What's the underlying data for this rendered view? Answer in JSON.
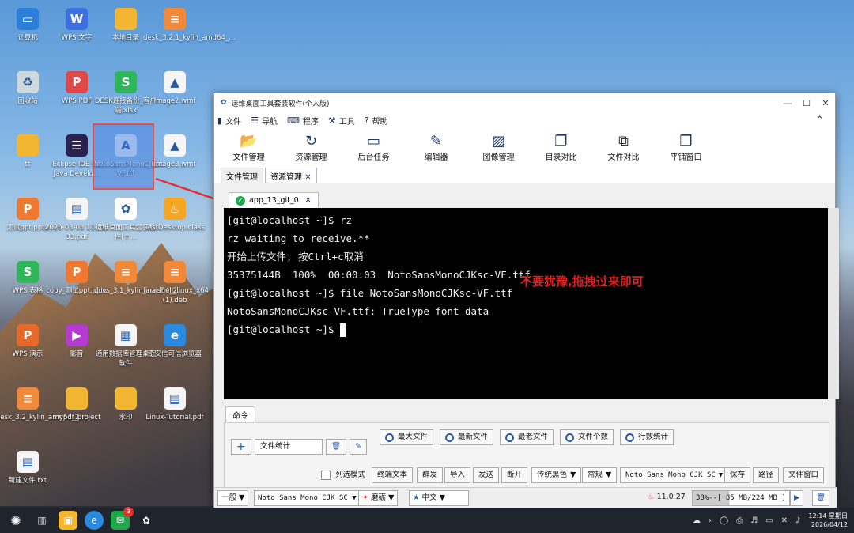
{
  "desktop": {
    "icons": [
      {
        "label": "计算机",
        "color": "#2b7fd8",
        "glyph": "▭",
        "icon": "computer-icon"
      },
      {
        "label": "WPS 文字",
        "color": "#3c6fe0",
        "glyph": "W",
        "icon": "wps-writer-icon"
      },
      {
        "label": "本地目录",
        "color": "#f2b632",
        "glyph": "",
        "icon": "folder-icon"
      },
      {
        "label": "desk_3.2.1_kylin_amd64_…",
        "color": "#f08a3a",
        "glyph": "≡",
        "icon": "archive-icon"
      },
      {
        "label": "回收站",
        "color": "#cfd8dc",
        "glyph": "♻",
        "icon": "trash-icon"
      },
      {
        "label": "WPS PDF",
        "color": "#e04848",
        "glyph": "P",
        "icon": "wps-pdf-icon"
      },
      {
        "label": "DESK连接备份_客户端.xlsx",
        "color": "#2fb55a",
        "glyph": "S",
        "icon": "xlsx-icon"
      },
      {
        "label": "image2.wmf",
        "color": "#f5f5f5",
        "glyph": "▲",
        "icon": "image-file-icon"
      },
      {
        "label": "tt",
        "color": "#f2b632",
        "glyph": "",
        "icon": "folder-icon"
      },
      {
        "label": "Eclipse IDE for Java Develo…",
        "color": "#2c2250",
        "glyph": "☰",
        "icon": "eclipse-icon"
      },
      {
        "label": "NotoSansMonoCJKsc-VF.ttf",
        "color": "#e8f0fc",
        "glyph": "A",
        "icon": "font-file-icon"
      },
      {
        "label": "image3.wmf",
        "color": "#f5f5f5",
        "glyph": "▲",
        "icon": "image-file-icon"
      },
      {
        "label": "测试ppt.pptx",
        "color": "#f07830",
        "glyph": "P",
        "icon": "pptx-icon"
      },
      {
        "label": "2026-03-08 11-05-33.pdf",
        "color": "#f5f5f5",
        "glyph": "▤",
        "icon": "pdf-file-icon"
      },
      {
        "label": "运维桌面工具套装软件(个…",
        "color": "#ffffff",
        "glyph": "✿",
        "icon": "app-logo-icon"
      },
      {
        "label": "TestDesktop.class",
        "color": "#f5a623",
        "glyph": "♨",
        "icon": "java-class-icon"
      },
      {
        "label": "WPS 表格",
        "color": "#2fb55a",
        "glyph": "S",
        "icon": "wps-sheet-icon"
      },
      {
        "label": "copy_测试ppt.pptx",
        "color": "#f07830",
        "glyph": "P",
        "icon": "pptx-icon"
      },
      {
        "label": "docs_3.1_kylin_amd64_2…",
        "color": "#f08a3a",
        "glyph": "≡",
        "icon": "archive-icon"
      },
      {
        "label": "finalshell_linux_x64 (1).deb",
        "color": "#f08a3a",
        "glyph": "≡",
        "icon": "deb-file-icon"
      },
      {
        "label": "WPS 演示",
        "color": "#e8682a",
        "glyph": "P",
        "icon": "wps-present-icon"
      },
      {
        "label": "影音",
        "color": "#b43ad0",
        "glyph": "▶",
        "icon": "media-player-icon"
      },
      {
        "label": "通用数据库管理桌面软件",
        "color": "#f5f5f5",
        "glyph": "▦",
        "icon": "db-app-icon"
      },
      {
        "label": "奇安信可信浏览器",
        "color": "#2a8ae0",
        "glyph": "e",
        "icon": "browser-icon"
      },
      {
        "label": "desk_3.2_kylin_amd64_2…",
        "color": "#f08a3a",
        "glyph": "≡",
        "icon": "archive-icon"
      },
      {
        "label": "mypdf_project",
        "color": "#f2b632",
        "glyph": "",
        "icon": "folder-icon"
      },
      {
        "label": "水印",
        "color": "#f2b632",
        "glyph": "",
        "icon": "folder-icon"
      },
      {
        "label": "Linux-Tutorial.pdf",
        "color": "#f5f5f5",
        "glyph": "▤",
        "icon": "pdf-file-icon"
      },
      {
        "label": "新建文件.txt",
        "color": "#f5f5f5",
        "glyph": "▤",
        "icon": "txt-file-icon"
      }
    ]
  },
  "window": {
    "title": "运维桌面工具套装软件(个人版)",
    "controls": [
      "—",
      "☐",
      "✕"
    ],
    "menu": [
      {
        "label": "文件",
        "glyph": "▮"
      },
      {
        "label": "导航",
        "glyph": "☰"
      },
      {
        "label": "程序",
        "glyph": "⌨"
      },
      {
        "label": "工具",
        "glyph": "⚒"
      },
      {
        "label": "帮助",
        "glyph": "?"
      }
    ],
    "collapse": "⌃",
    "toolbar": [
      {
        "label": "文件管理",
        "glyph": "📂"
      },
      {
        "label": "资源管理",
        "glyph": "↻"
      },
      {
        "label": "后台任务",
        "glyph": "▭"
      },
      {
        "label": "编辑器",
        "glyph": "✎"
      },
      {
        "label": "图像管理",
        "glyph": "▨"
      },
      {
        "label": "目录对比",
        "glyph": "❐"
      },
      {
        "label": "文件对比",
        "glyph": "⧉"
      },
      {
        "label": "平铺窗口",
        "glyph": "❒"
      }
    ],
    "tabs": [
      "文件管理",
      "资源管理"
    ],
    "tab_close": "✕",
    "session_tab": "app_13_git_0",
    "session_close": "✕",
    "terminal": [
      "[git@localhost ~]$ rz",
      "rz waiting to receive.**",
      "开始上传文件, 按Ctrl+c取消",
      "35375144B  100%  00:00:03  NotoSansMonoCJKsc-VF.ttf",
      "[git@localhost ~]$ file NotoSansMonoCJKsc-VF.ttf",
      "NotoSansMonoCJKsc-VF.ttf: TrueType font data",
      "[git@localhost ~]$ "
    ],
    "command_tab": "命令",
    "cmd_buttons": [
      "最大文件",
      "最新文件",
      "最老文件",
      "文件个数",
      "行数统计"
    ],
    "stat_input": "文件统计",
    "add": "+",
    "del": "🗑",
    "edit": "✎",
    "column_mode": "列选模式",
    "bottom_buttons": [
      "终端文本",
      "群发",
      "导入",
      "发送",
      "断开"
    ],
    "theme": "传统黑色",
    "normal": "常规",
    "font": "Noto Sans Mono CJK SC",
    "right_buttons": [
      "保存",
      "路径",
      "文件窗口"
    ],
    "status": {
      "general": "一般",
      "font": "Noto Sans Mono CJK SC",
      "encoding": "磨砺",
      "lang": "中文",
      "version": "11.0.27",
      "memory": "38%--[ 85 MB/224 MB ]",
      "run": "▶",
      "trash": "🗑"
    }
  },
  "annotation": "不要犹豫,拖拽过来即可",
  "taskbar": {
    "badge": "3",
    "time": "12:14 星期日",
    "date": "2026/04/12"
  }
}
